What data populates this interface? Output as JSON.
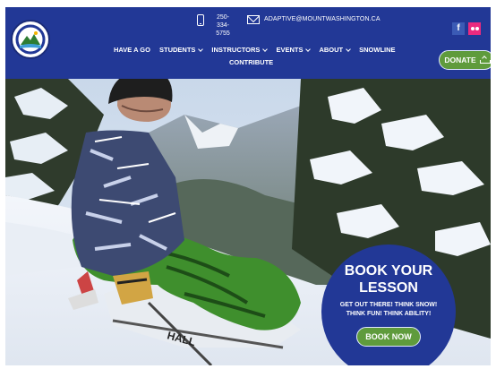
{
  "header": {
    "phone": "250-334-5755",
    "email": "ADAPTIVE@MOUNTWASHINGTON.CA",
    "social": {
      "facebook": "f"
    },
    "donate_label": "DONATE"
  },
  "nav": {
    "items": [
      {
        "label": "HAVE A GO",
        "dropdown": false
      },
      {
        "label": "STUDENTS",
        "dropdown": true
      },
      {
        "label": "INSTRUCTORS",
        "dropdown": true
      },
      {
        "label": "EVENTS",
        "dropdown": true
      },
      {
        "label": "ABOUT",
        "dropdown": true
      },
      {
        "label": "SNOWLINE",
        "dropdown": false
      }
    ],
    "second_row": "CONTRIBUTE"
  },
  "hero": {
    "book_title": "BOOK YOUR LESSON",
    "book_text": "GET OUT THERE! THINK SNOW! THINK FUN! THINK ABILITY!",
    "book_button": "BOOK NOW",
    "sit_ski_text": "HALL"
  },
  "colors": {
    "header_blue": "#223896",
    "button_green": "#5f9b3c",
    "facebook": "#3b5bb5",
    "flickr": "#ea2a7f"
  },
  "icons": [
    "logo",
    "phone-icon",
    "mail-icon",
    "facebook-icon",
    "flickr-icon",
    "chevron-down-icon",
    "donate-icon"
  ]
}
